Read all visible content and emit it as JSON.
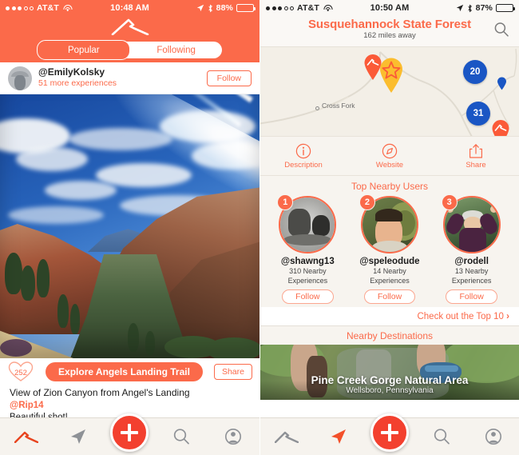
{
  "left": {
    "status": {
      "carrier": "AT&T",
      "time": "10:48 AM",
      "battery_pct": "88%"
    },
    "segments": [
      {
        "label": "Popular",
        "active": true
      },
      {
        "label": "Following",
        "active": false
      }
    ],
    "user_row": {
      "handle": "@EmilyKolsky",
      "subtitle": "51 more experiences",
      "follow_label": "Follow"
    },
    "photo_alt": "View of Zion Canyon",
    "actions": {
      "like_count": "252",
      "explore_label": "Explore Angels Landing Trail",
      "share_label": "Share"
    },
    "caption": {
      "title": "View of Zion Canyon from Angel's Landing",
      "handle": "@Rip14",
      "comment": "Beautiful shot!"
    },
    "tabs": [
      {
        "name": "feed",
        "icon": "mountain-icon",
        "active": true
      },
      {
        "name": "explore",
        "icon": "navigation-arrow-icon",
        "active": false
      },
      {
        "name": "add",
        "icon": "plus-icon",
        "active": false
      },
      {
        "name": "search",
        "icon": "search-icon",
        "active": false
      },
      {
        "name": "profile",
        "icon": "person-icon",
        "active": false
      }
    ]
  },
  "right": {
    "status": {
      "carrier": "AT&T",
      "time": "10:50 AM",
      "battery_pct": "87%"
    },
    "header": {
      "title": "Susquehannock State Forest",
      "subtitle": "162 miles away",
      "search_icon": "search-icon"
    },
    "map": {
      "place_label": "Cross Fork",
      "clusters": [
        {
          "count": "20"
        },
        {
          "count": "31"
        }
      ],
      "pins": [
        {
          "type": "mountain-pin",
          "color": "#fb6a4a"
        },
        {
          "type": "star-pin",
          "color": "#fbbd2e"
        },
        {
          "type": "mountain-pin",
          "color": "#fb6a4a"
        },
        {
          "type": "small-blue-pin",
          "color": "#1a56c4"
        }
      ]
    },
    "actions": [
      {
        "icon": "info-circle-icon",
        "label": "Description"
      },
      {
        "icon": "compass-icon",
        "label": "Website"
      },
      {
        "icon": "share-upload-icon",
        "label": "Share"
      }
    ],
    "nearby_users": {
      "title": "Top Nearby Users",
      "items": [
        {
          "rank": "1",
          "handle": "@shawng13",
          "count": "310 Nearby",
          "count2": "Experiences",
          "follow": "Follow"
        },
        {
          "rank": "2",
          "handle": "@speleodude",
          "count": "14 Nearby",
          "count2": "Experiences",
          "follow": "Follow"
        },
        {
          "rank": "3",
          "handle": "@rodell",
          "count": "13 Nearby",
          "count2": "Experiences",
          "follow": "Follow"
        }
      ],
      "top10_label": "Check out the Top 10"
    },
    "destinations": {
      "title": "Nearby Destinations",
      "card": {
        "name": "Pine Creek Gorge Natural Area",
        "location": "Wellsboro, Pennsylvania"
      }
    },
    "tabs": [
      {
        "name": "feed",
        "icon": "mountain-icon",
        "active": false
      },
      {
        "name": "explore",
        "icon": "navigation-arrow-icon",
        "active": true
      },
      {
        "name": "add",
        "icon": "plus-icon",
        "active": false
      },
      {
        "name": "search",
        "icon": "search-icon",
        "active": false
      },
      {
        "name": "profile",
        "icon": "person-icon",
        "active": false
      }
    ]
  },
  "colors": {
    "accent": "#fb6a4a",
    "plus": "#f3402f",
    "cluster": "#1a56c4",
    "star_pin": "#fbbd2e"
  }
}
